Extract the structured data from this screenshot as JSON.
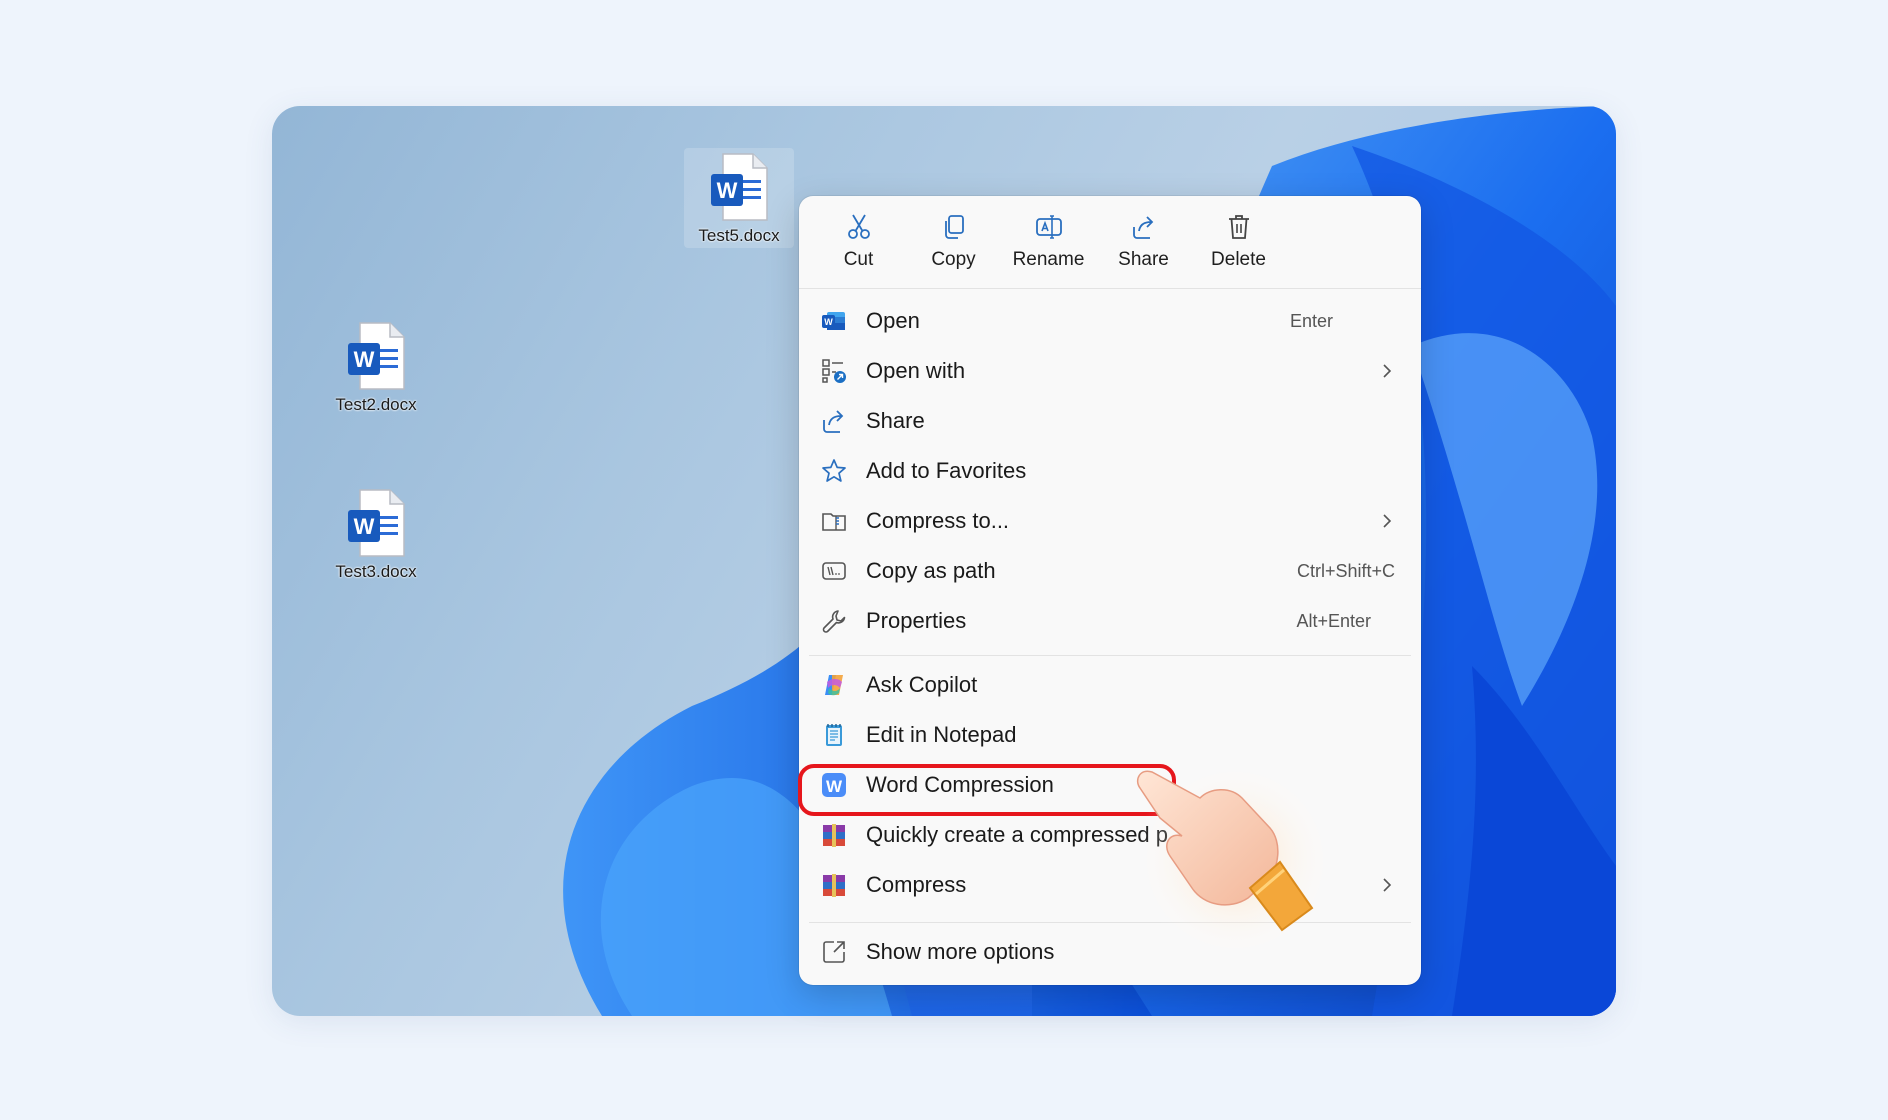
{
  "desktop": {
    "icons": [
      {
        "label": "Test5.docx"
      },
      {
        "label": "Test2.docx"
      },
      {
        "label": "Test3.docx"
      }
    ]
  },
  "menu": {
    "toolbar": [
      {
        "label": "Cut",
        "icon": "scissors-icon"
      },
      {
        "label": "Copy",
        "icon": "copy-icon"
      },
      {
        "label": "Rename",
        "icon": "rename-icon"
      },
      {
        "label": "Share",
        "icon": "share-icon"
      },
      {
        "label": "Delete",
        "icon": "trash-icon"
      }
    ],
    "items": [
      {
        "label": "Open",
        "shortcut": "Enter",
        "icon": "word-icon"
      },
      {
        "label": "Open with",
        "shortcut": "",
        "icon": "open-with-icon"
      },
      {
        "label": "Share",
        "shortcut": "",
        "icon": "share-icon"
      },
      {
        "label": "Add to Favorites",
        "shortcut": "",
        "icon": "star-icon"
      },
      {
        "label": "Compress to...",
        "shortcut": "",
        "icon": "zip-folder-icon"
      },
      {
        "label": "Copy as path",
        "shortcut": "Ctrl+Shift+C",
        "icon": "path-icon"
      },
      {
        "label": "Properties",
        "shortcut": "Alt+Enter",
        "icon": "wrench-icon"
      },
      {
        "label": "Ask Copilot",
        "shortcut": "",
        "icon": "copilot-icon"
      },
      {
        "label": "Edit in Notepad",
        "shortcut": "",
        "icon": "notepad-icon"
      },
      {
        "label": "Word Compression",
        "shortcut": "",
        "icon": "word-compression-icon"
      },
      {
        "label": "Quickly create a compressed p",
        "shortcut": "",
        "icon": "winrar-icon"
      },
      {
        "label": "Compress",
        "shortcut": "",
        "icon": "winrar-icon"
      },
      {
        "label": "Show more options",
        "shortcut": "",
        "icon": "expand-icon"
      }
    ]
  },
  "colors": {
    "accent": "#0f6cbd",
    "highlight": "#e6161c",
    "word_blue": "#185abd"
  }
}
